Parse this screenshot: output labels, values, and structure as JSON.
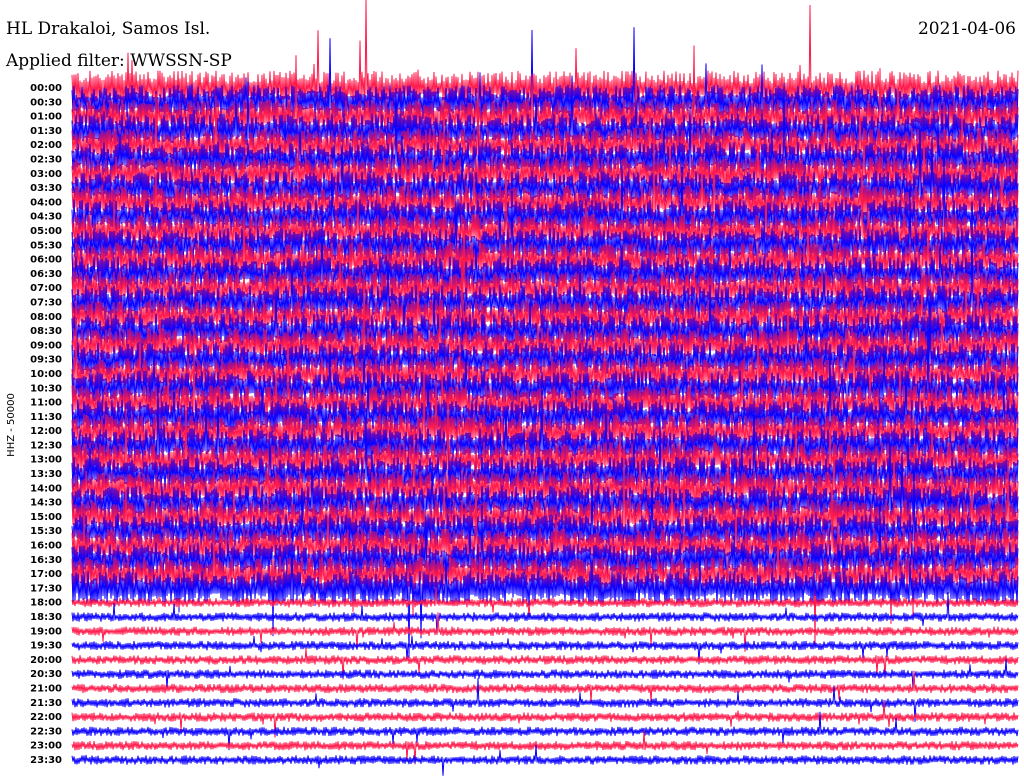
{
  "header": {
    "station": "HL Drakaloi, Samos Isl.",
    "filter_label": "Applied filter: WWSSN-SP",
    "date": "2021-04-06"
  },
  "chart_data": {
    "type": "line",
    "title": "HL Drakaloi, Samos Isl.",
    "subtitle": "Applied filter: WWSSN-SP",
    "date": "2021-04-06",
    "ylabel": "HHZ - 50000",
    "row_labels": [
      "00:00",
      "00:30",
      "01:00",
      "01:30",
      "02:00",
      "02:30",
      "03:00",
      "03:30",
      "04:00",
      "04:30",
      "05:00",
      "05:30",
      "06:00",
      "06:30",
      "07:00",
      "07:30",
      "08:00",
      "08:30",
      "09:00",
      "09:30",
      "10:00",
      "10:30",
      "11:00",
      "11:30",
      "12:00",
      "12:30",
      "13:00",
      "13:30",
      "14:00",
      "14:30",
      "15:00",
      "15:30",
      "16:00",
      "16:30",
      "17:00",
      "17:30",
      "18:00",
      "18:30",
      "19:00",
      "19:30",
      "20:00",
      "20:30",
      "21:00",
      "21:30",
      "22:00",
      "22:30",
      "23:00",
      "23:30"
    ],
    "series_colors": [
      "#ff1a4b",
      "#0a00ff"
    ],
    "row_minutes": 30,
    "noisy_until_row": 35,
    "grid": false
  }
}
